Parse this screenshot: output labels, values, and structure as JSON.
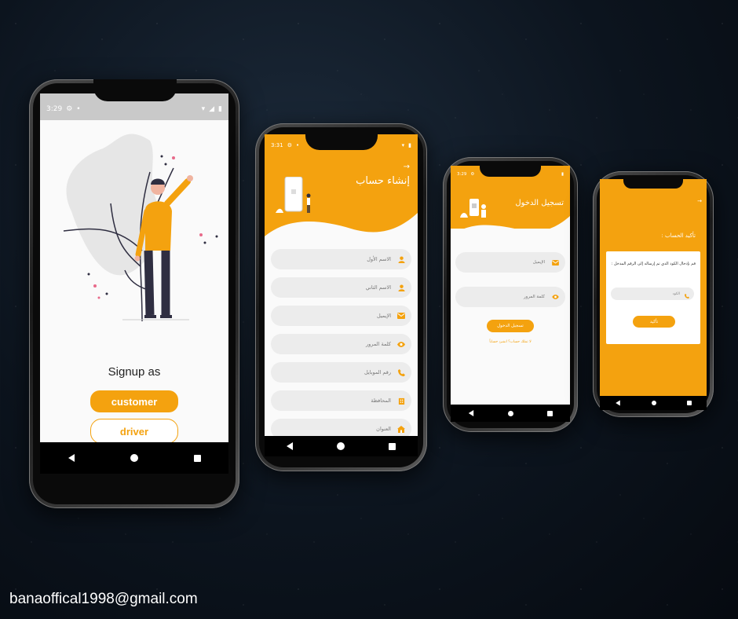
{
  "phone1": {
    "status_time": "3:29",
    "signup_label": "Signup as",
    "customer_button": "customer",
    "driver_button": "driver"
  },
  "phone2": {
    "status_time": "3:31",
    "title": "إنشاء حساب",
    "fields": [
      {
        "label": "الاسم الأول",
        "icon": "person-icon"
      },
      {
        "label": "الاسم الثاني",
        "icon": "person-icon"
      },
      {
        "label": "الإيميل",
        "icon": "mail-icon"
      },
      {
        "label": "كلمة المرور",
        "icon": "eye-icon"
      },
      {
        "label": "رقم الموبايل",
        "icon": "phone-icon"
      },
      {
        "label": "المحافظة",
        "icon": "building-icon"
      },
      {
        "label": "العنوان",
        "icon": "home-icon"
      }
    ]
  },
  "phone3": {
    "status_time": "3:29",
    "title": "تسجيل الدخول",
    "email_label": "الإيميل",
    "password_label": "كلمة المرور",
    "login_button": "تسجيل الدخول",
    "signup_link": "لا تملك حساب؟ انشئ حساباً"
  },
  "phone4": {
    "title": "تأكيد الحساب :",
    "message": "قم بإدخال الكود الذي تم إرساله إلى الرقم المدخل :",
    "code_placeholder": "الكود",
    "confirm_button": "تأكيد"
  },
  "contact_email": "banaoffical1998@gmail.com",
  "colors": {
    "accent": "#f4a20f",
    "field_bg": "#ececec",
    "background": "#0c141e"
  }
}
